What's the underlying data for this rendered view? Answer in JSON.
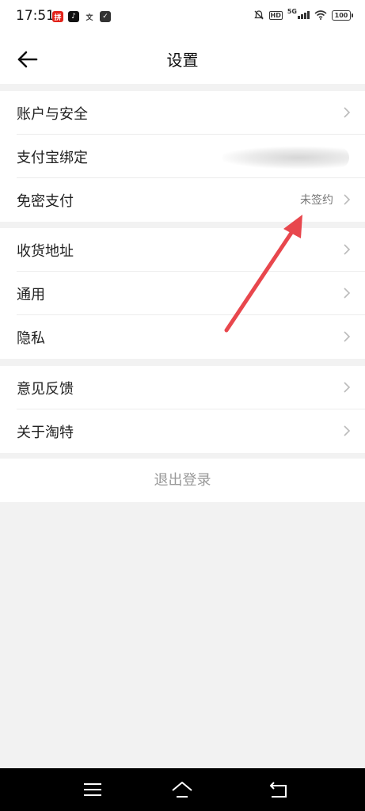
{
  "status_bar": {
    "time": "17:51",
    "app_badges": [
      "拼",
      "♪",
      "文",
      "✓"
    ],
    "network": "5G",
    "hd": "HD",
    "battery": "100"
  },
  "header": {
    "title": "设置"
  },
  "sections": [
    {
      "items": [
        {
          "label": "账户与安全",
          "value": ""
        },
        {
          "label": "支付宝绑定",
          "value": ""
        },
        {
          "label": "免密支付",
          "value": "未签约"
        }
      ]
    },
    {
      "items": [
        {
          "label": "收货地址",
          "value": ""
        },
        {
          "label": "通用",
          "value": ""
        },
        {
          "label": "隐私",
          "value": ""
        }
      ]
    },
    {
      "items": [
        {
          "label": "意见反馈",
          "value": ""
        },
        {
          "label": "关于淘特",
          "value": ""
        }
      ]
    }
  ],
  "logout": {
    "label": "退出登录"
  },
  "colors": {
    "annotation_arrow": "#e8474d",
    "background": "#f2f2f2"
  }
}
